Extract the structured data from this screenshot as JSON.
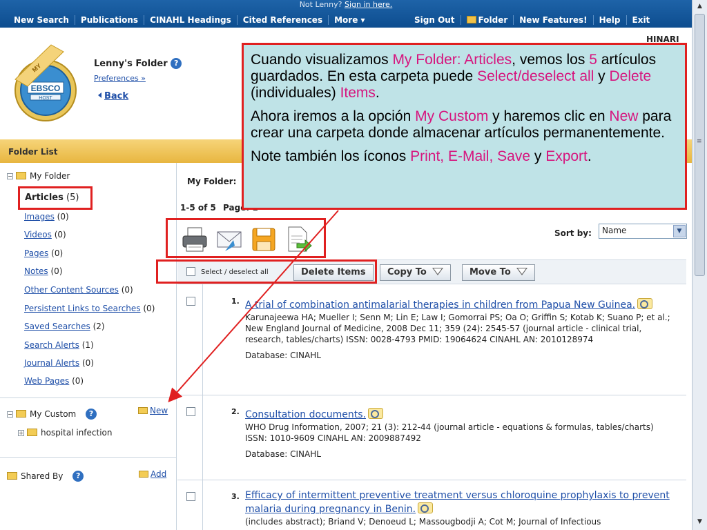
{
  "topbar": {
    "not_user": "Not Lenny?",
    "sign_in": "Sign in here.",
    "left_items": [
      "New Search",
      "Publications",
      "CINAHL Headings",
      "Cited References",
      "More ▾"
    ],
    "right_items": [
      "Sign Out",
      "Folder",
      "New Features!",
      "Help",
      "Exit"
    ]
  },
  "header": {
    "institution": "HINARI",
    "logo_text": "EBSCO",
    "logo_sub": "HOST",
    "logo_banner": "MY",
    "folder_title": "Lenny's Folder",
    "preferences": "Preferences »",
    "back": "Back"
  },
  "folder_list": {
    "title": "Folder List"
  },
  "sidebar": {
    "my_folder": "My Folder",
    "articles_label": "Articles",
    "articles_count": "(5)",
    "links": [
      {
        "label": "Images",
        "count": "(0)"
      },
      {
        "label": "Videos",
        "count": "(0)"
      },
      {
        "label": "Pages",
        "count": "(0)"
      },
      {
        "label": "Notes",
        "count": "(0)"
      },
      {
        "label": "Other Content Sources",
        "count": "(0)"
      },
      {
        "label": "Persistent Links to Searches",
        "count": "(0)"
      },
      {
        "label": "Saved Searches",
        "count": "(2)"
      },
      {
        "label": "Search Alerts",
        "count": "(1)"
      },
      {
        "label": "Journal Alerts",
        "count": "(0)"
      },
      {
        "label": "Web Pages",
        "count": "(0)"
      }
    ],
    "my_custom": "My Custom",
    "new_label": "New",
    "custom_folder": "hospital infection",
    "shared_by": "Shared By",
    "add_label": "Add"
  },
  "main": {
    "my_folder_label": "My Folder:",
    "range": "1-5 of 5",
    "page_label": "Page: 1",
    "sort_by_label": "Sort by:",
    "sort_value": "Name",
    "select_all": "Select / deselect all",
    "delete_items": "Delete Items",
    "copy_to": "Copy To",
    "move_to": "Move To"
  },
  "results": [
    {
      "num": "1.",
      "title": "A trial of combination antimalarial therapies in children from Papua New Guinea.",
      "details": "Karunajeewa HA; Mueller I; Senn M; Lin E; Law I; Gomorrai PS; Oa O; Griffin S; Kotab K; Suano P; et al.; New England Journal of Medicine, 2008 Dec 11; 359 (24): 2545-57 (journal article - clinical trial, research, tables/charts) ISSN: 0028-4793 PMID: 19064624 CINAHL AN: 2010128974",
      "database": "Database: CINAHL"
    },
    {
      "num": "2.",
      "title": "Consultation documents.",
      "details": "WHO Drug Information, 2007; 21 (3): 212-44 (journal article - equations & formulas, tables/charts) ISSN: 1010-9609 CINAHL AN: 2009887492",
      "database": "Database: CINAHL"
    },
    {
      "num": "3.",
      "title": "Efficacy of intermittent preventive treatment versus chloroquine prophylaxis to prevent malaria during pregnancy in Benin.",
      "details": "(includes abstract); Briand V; Denoeud L; Massougbodji A; Cot M; Journal of Infectious",
      "database": ""
    }
  ],
  "callout": {
    "p1_a": "Cuando visualizamos ",
    "p1_b": "My Folder: Articles",
    "p1_c": ", vemos los ",
    "p1_d": "5",
    "p1_e": " artículos guardados.  En esta carpeta puede ",
    "p1_f": "Select/deselect all",
    "p1_g": " y ",
    "p1_h": "Delete",
    "p1_i": " (individuales) ",
    "p1_j": "Items",
    "p1_k": ".",
    "p2_a": "Ahora iremos a la opción ",
    "p2_b": "My Custom",
    "p2_c": " y haremos clic en ",
    "p2_d": "New",
    "p2_e": " para crear una carpeta donde almacenar artículos permanentemente.",
    "p3_a": "Note también los íconos ",
    "p3_b": "Print, E-Mail, Save",
    "p3_c": " y ",
    "p3_d": "Export",
    "p3_e": "."
  },
  "colors": {
    "nav_bg": "#0d4d8f",
    "folder_bar": "#e8b640",
    "callout_bg": "#bfe3e7",
    "highlight": "#d6157e",
    "annotation_red": "#e02020",
    "link": "#1f4fa8"
  },
  "icons": [
    "folder-icon",
    "help-icon",
    "print-icon",
    "email-icon",
    "save-icon",
    "export-icon",
    "magnifier-icon",
    "chevron-down-icon"
  ]
}
